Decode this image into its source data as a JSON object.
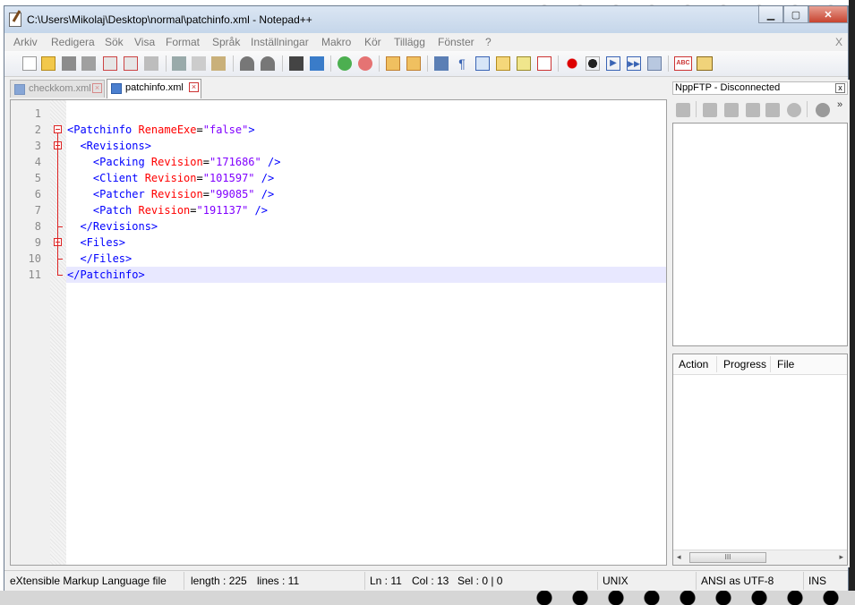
{
  "window": {
    "title": "C:\\Users\\Mikolaj\\Desktop\\normal\\patchinfo.xml - Notepad++"
  },
  "menu": [
    "Arkiv",
    "Redigera",
    "Sök",
    "Visa",
    "Format",
    "Språk",
    "Inställningar",
    "Makro",
    "Kör",
    "Tillägg",
    "Fönster",
    "?"
  ],
  "menu_close": "X",
  "tabs": [
    {
      "label": "checkkom.xml",
      "active": false
    },
    {
      "label": "patchinfo.xml",
      "active": true
    }
  ],
  "editor": {
    "lines": [
      {
        "n": "1",
        "tokens": []
      },
      {
        "n": "2",
        "tokens": [
          [
            "tag",
            "<Patchinfo "
          ],
          [
            "attr",
            "RenameExe"
          ],
          [
            "eq",
            "="
          ],
          [
            "val",
            "\"false\""
          ],
          [
            "tag",
            ">"
          ]
        ]
      },
      {
        "n": "3",
        "tokens": [
          [
            "tag",
            "  <Revisions>"
          ]
        ]
      },
      {
        "n": "4",
        "tokens": [
          [
            "tag",
            "    <Packing "
          ],
          [
            "attr",
            "Revision"
          ],
          [
            "eq",
            "="
          ],
          [
            "val",
            "\"171686\""
          ],
          [
            "tag",
            " />"
          ]
        ]
      },
      {
        "n": "5",
        "tokens": [
          [
            "tag",
            "    <Client "
          ],
          [
            "attr",
            "Revision"
          ],
          [
            "eq",
            "="
          ],
          [
            "val",
            "\"101597\""
          ],
          [
            "tag",
            " />"
          ]
        ]
      },
      {
        "n": "6",
        "tokens": [
          [
            "tag",
            "    <Patcher "
          ],
          [
            "attr",
            "Revision"
          ],
          [
            "eq",
            "="
          ],
          [
            "val",
            "\"99085\""
          ],
          [
            "tag",
            " />"
          ]
        ]
      },
      {
        "n": "7",
        "tokens": [
          [
            "tag",
            "    <Patch "
          ],
          [
            "attr",
            "Revision"
          ],
          [
            "eq",
            "="
          ],
          [
            "val",
            "\"191137\""
          ],
          [
            "tag",
            " />"
          ]
        ]
      },
      {
        "n": "8",
        "tokens": [
          [
            "tag",
            "  </Revisions>"
          ]
        ]
      },
      {
        "n": "9",
        "tokens": [
          [
            "tag",
            "  <Files>"
          ]
        ]
      },
      {
        "n": "10",
        "tokens": [
          [
            "tag",
            "  </Files>"
          ]
        ]
      },
      {
        "n": "11",
        "tokens": [
          [
            "tag",
            "</Patchinfo>"
          ]
        ]
      }
    ],
    "current_line": 11
  },
  "panel": {
    "title": "NppFTP - Disconnected",
    "close": "x",
    "overflow": "»",
    "queue_columns": [
      "Action",
      "Progress",
      "File"
    ],
    "scroll_thumb": "III",
    "scroll_left": "◂",
    "scroll_right": "▸"
  },
  "status": {
    "filetype": "eXtensible Markup Language file",
    "length": "length : 225",
    "lines": "lines : 11",
    "ln": "Ln : 11",
    "col": "Col : 13",
    "sel": "Sel : 0 | 0",
    "eol": "UNIX",
    "encoding": "ANSI as UTF-8",
    "mode": "INS"
  },
  "colors": {
    "tag": "#0000ff",
    "attr": "#ff0000",
    "value": "#8000ff",
    "fold": "#dd2222",
    "current_line": "#e8e8ff"
  }
}
